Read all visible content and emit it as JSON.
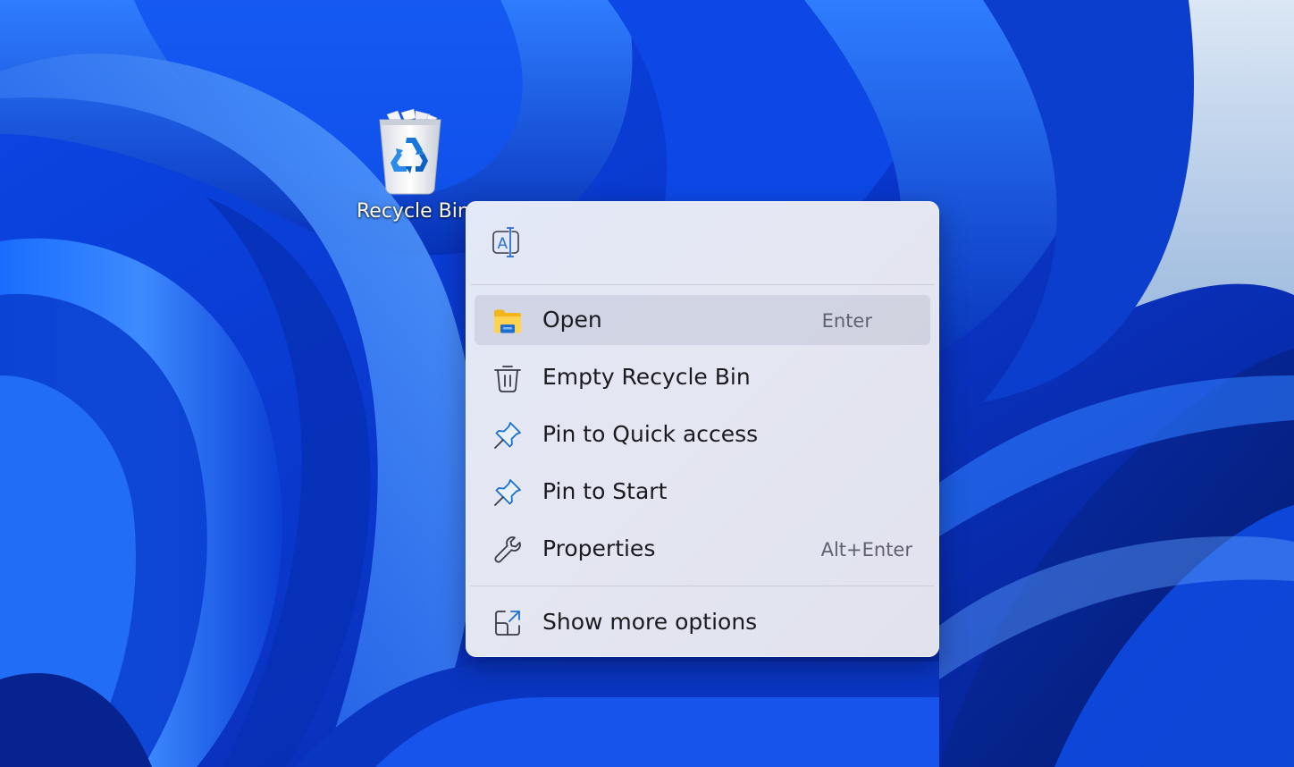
{
  "desktop": {
    "recycle_bin_label": "Recycle Bin"
  },
  "context_menu": {
    "top_actions": [
      {
        "icon": "rename-icon",
        "label": "Rename"
      }
    ],
    "items": [
      {
        "icon": "folder-icon",
        "label": "Open",
        "accelerator": "Enter",
        "highlighted": true
      },
      {
        "icon": "trash-can-icon",
        "label": "Empty Recycle Bin",
        "accelerator": ""
      },
      {
        "icon": "pin-icon",
        "label": "Pin to Quick access",
        "accelerator": ""
      },
      {
        "icon": "pin-icon",
        "label": "Pin to Start",
        "accelerator": ""
      },
      {
        "icon": "wrench-icon",
        "label": "Properties",
        "accelerator": "Alt+Enter"
      }
    ],
    "footer_item": {
      "icon": "expand-icon",
      "label": "Show more options"
    }
  },
  "colors": {
    "accent": "#0067c0",
    "menu_background": "#e4e6f1",
    "wallpaper_base": "#0a3cd8"
  }
}
